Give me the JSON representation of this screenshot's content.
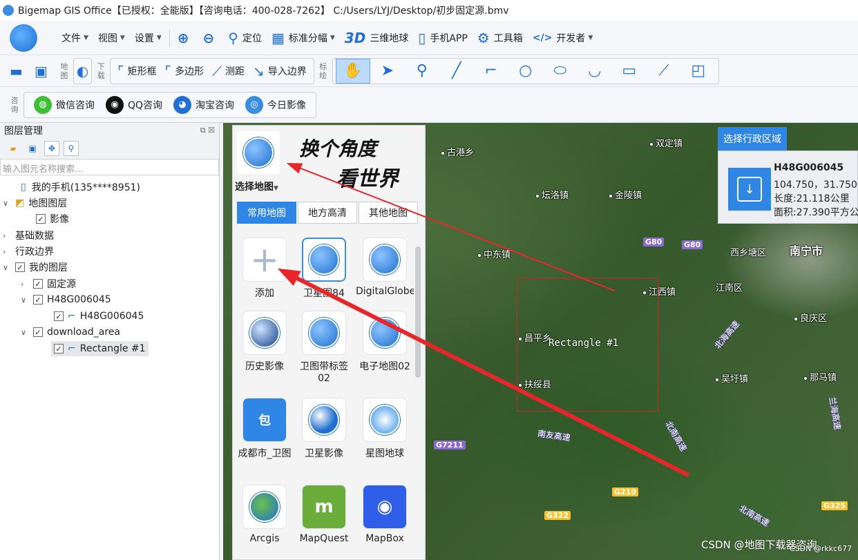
{
  "title": "Bigemap GIS Office【已授权：全能版】【咨询电话：400-028-7262】 C:/Users/LYJ/Desktop/初步固定源.bmv",
  "menu": [
    {
      "label": "文件",
      "caret": true,
      "icon": "file-icon"
    },
    {
      "label": "视图",
      "caret": true,
      "icon": "view-icon"
    },
    {
      "label": "设置",
      "caret": true,
      "icon": "settings-icon"
    },
    {
      "label": "",
      "icon": "zoom-in-icon"
    },
    {
      "label": "",
      "icon": "zoom-out-icon"
    },
    {
      "label": "定位",
      "icon": "locate-icon"
    },
    {
      "label": "标准分幅",
      "caret": true,
      "icon": "grid-icon"
    },
    {
      "label": "三维地球",
      "icon": "3d-icon"
    },
    {
      "label": "手机APP",
      "icon": "phone-icon"
    },
    {
      "label": "工具箱",
      "icon": "gear-icon"
    },
    {
      "label": "开发者",
      "caret": true,
      "icon": "code-icon"
    }
  ],
  "toolbar2": {
    "map_label": "地图",
    "download_label": "下载",
    "rect_label": "矩形框",
    "polygon_label": "多边形",
    "measure_label": "测距",
    "import_label": "导入边界",
    "draw_label": "标绘"
  },
  "consult": {
    "label": "咨询",
    "items": [
      "微信咨询",
      "QQ咨询",
      "淘宝咨询",
      "今日影像"
    ]
  },
  "layer_panel": {
    "title": "图层管理",
    "search_placeholder": "输入图元名称搜索...",
    "items": [
      {
        "label": "我的手机(135****8951)"
      },
      {
        "label": "地图图层"
      },
      {
        "label": "影像"
      },
      {
        "label": "基础数据"
      },
      {
        "label": "行政边界"
      },
      {
        "label": "我的图层"
      },
      {
        "label": "固定源"
      },
      {
        "label": "H48G006045"
      },
      {
        "label": "H48G006045"
      },
      {
        "label": "download_area"
      },
      {
        "label": "Rectangle #1"
      }
    ]
  },
  "select_map": {
    "title": "选择地图",
    "handwritten_1": "换个角度",
    "handwritten_2": "看世界",
    "tabs": [
      "常用地图",
      "地方高清",
      "其他地图"
    ],
    "items": [
      "添加",
      "卫星图84",
      "DigitalGlobe",
      "历史影像",
      "卫图带标签02",
      "电子地图02",
      "成都市_卫图",
      "卫星影像",
      "星图地球",
      "Arcgis",
      "MapQuest",
      "MapBox"
    ]
  },
  "region_panel": {
    "title": "选择行政区域",
    "name": "H48G006045",
    "coords": "104.750，31.750",
    "length": "长度:21.118公里",
    "area": "面积:27.390平方公"
  },
  "map": {
    "places": [
      "古港乡",
      "双定镇",
      "坛洛镇",
      "金陵镇",
      "中东镇",
      "西乡塘区",
      "南宁市",
      "江西镇",
      "江南区",
      "良庆区",
      "昌平乡",
      "扶绥县",
      "吴圩镇",
      "那马镇"
    ],
    "roads": [
      "G80",
      "G80",
      "G7211",
      "G210",
      "G322",
      "G325"
    ],
    "highways": [
      "南友高速",
      "北南高速",
      "北海高速",
      "北南高速",
      "兰海高速"
    ],
    "rect_label": "Rectangle #1",
    "watermark": "CSDN @地图下载器咨询",
    "watermark_small": "CSDN @rkkc677"
  },
  "colors": {
    "accent": "#1f6fd6",
    "tab_active": "#2f86e4",
    "arrow": "#e8252b",
    "rect": "#c62828"
  }
}
